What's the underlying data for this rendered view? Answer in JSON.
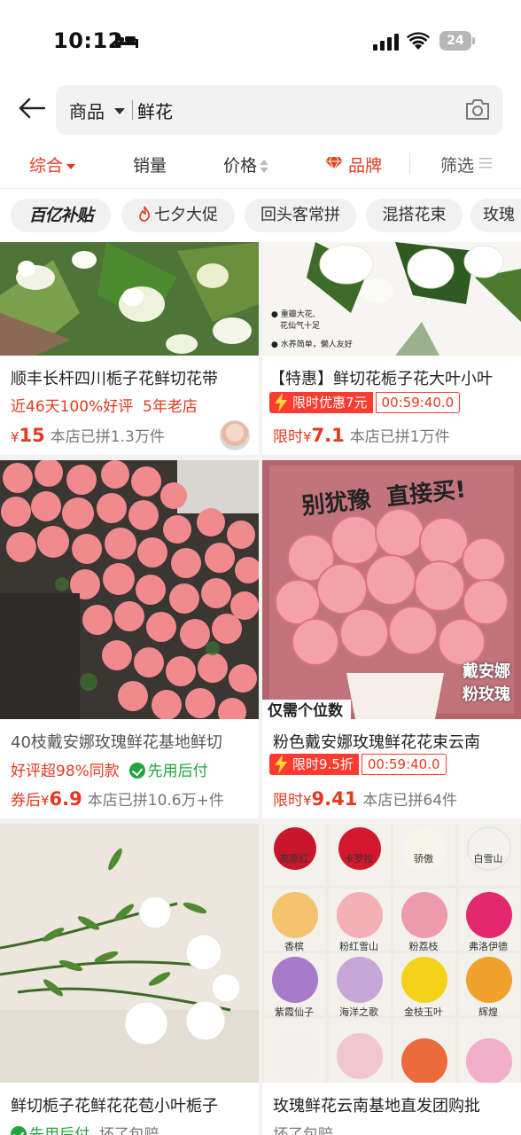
{
  "status_bar": {
    "time": "10:12",
    "battery": "24"
  },
  "search": {
    "scope": "商品",
    "query": "鲜花"
  },
  "sort_tabs": [
    "综合",
    "销量",
    "价格",
    "品牌",
    "筛选"
  ],
  "chips": [
    {
      "label": "百亿补贴"
    },
    {
      "label": "七夕大促"
    },
    {
      "label": "回头客常拼"
    },
    {
      "label": "混搭花束"
    },
    {
      "label": "玫瑰"
    }
  ],
  "products": [
    {
      "title": "顺丰长杆四川栀子花鲜切花带",
      "reviews": "近46天100%好评",
      "store_age": "5年老店",
      "price_prefix": "",
      "price": "15",
      "sales": "本店已拼1.3万件"
    },
    {
      "title": "【特惠】鲜切花栀子花大叶小叶",
      "promo": "限时优惠7元",
      "timer": "00:59:40.0",
      "price_prefix": "限时",
      "price": "7.1",
      "sales": "本店已拼1万件",
      "image_captions": [
        "重瓣大花,",
        "花仙气十足",
        "水养简单，懒人友好"
      ]
    },
    {
      "title": "40枝戴安娜玫瑰鲜花基地鲜切",
      "reviews": "好评超98%同款",
      "service": "先用后付",
      "price_prefix": "券后",
      "price": "6.9",
      "sales": "本店已拼10.6万+件"
    },
    {
      "title": "粉色戴安娜玫瑰鲜花花束云南",
      "promo": "限时9.5折",
      "timer": "00:59:40.0",
      "price_prefix": "限时",
      "price": "9.41",
      "sales": "本店已拼64件",
      "image_captions": {
        "headline_1": "别犹豫",
        "headline_2": "直接买!",
        "bottom": "仅需个位数",
        "side_1": "戴安娜",
        "side_2": "粉玫瑰"
      }
    },
    {
      "title": "鲜切栀子花鲜花花苞小叶栀子",
      "service": "先用后付",
      "extra": "坏了包赔"
    },
    {
      "title": "玫瑰鲜花云南基地直发团购批",
      "extra": "坏了包赔",
      "flower_labels": [
        "高原红",
        "卡罗拉",
        "骄傲",
        "白雪山",
        "香槟",
        "粉红雪山",
        "粉荔枝",
        "弗洛伊德",
        "紫霞仙子",
        "海洋之歌",
        "金枝玉叶",
        "辉煌"
      ]
    }
  ],
  "colors": {
    "accent": "#e4391f",
    "green": "#21a33f",
    "background": "#f2f2f2"
  }
}
